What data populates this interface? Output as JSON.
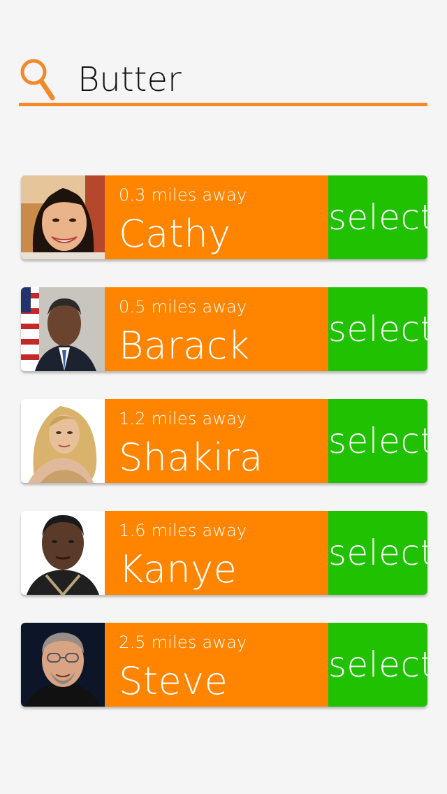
{
  "search": {
    "value": "Butter",
    "icon": "search-icon",
    "accent_color": "#f18a2b"
  },
  "colors": {
    "info_bg": "#ff8400",
    "select_bg": "#20c100",
    "page_bg": "#f5f5f5"
  },
  "results": [
    {
      "distance": "0.3 miles away",
      "name": "Cathy",
      "select_label": "select",
      "avatar": "photo-cathy"
    },
    {
      "distance": "0.5 miles away",
      "name": "Barack",
      "select_label": "select",
      "avatar": "photo-barack"
    },
    {
      "distance": "1.2 miles away",
      "name": "Shakira",
      "select_label": "select",
      "avatar": "photo-shakira"
    },
    {
      "distance": "1.6 miles away",
      "name": "Kanye",
      "select_label": "select",
      "avatar": "photo-kanye"
    },
    {
      "distance": "2.5 miles away",
      "name": "Steve",
      "select_label": "select",
      "avatar": "photo-steve"
    }
  ]
}
